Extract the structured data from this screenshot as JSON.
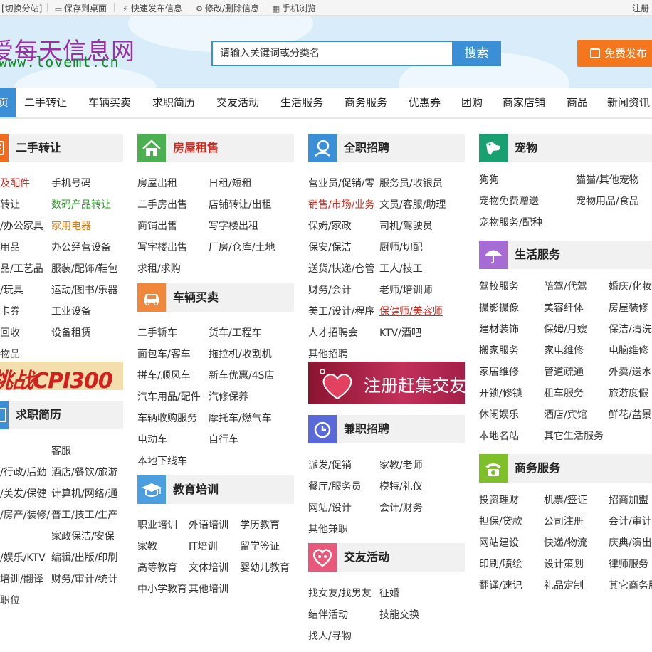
{
  "topbar": {
    "switch_site": "[切换分站]",
    "save_desktop": "保存到桌面",
    "quick_publish": "快速发布信息",
    "edit_delete": "修改/删除信息",
    "mobile_browse": "手机浏览",
    "register": "注册"
  },
  "header": {
    "logo_cn": "爱每天信息网",
    "logo_en": "www.lovemt.cn",
    "search_placeholder": "请输入关键词或分类名",
    "search_button": "搜索",
    "publish_button": "免费发布"
  },
  "nav": {
    "home": "页",
    "items": [
      "二手转让",
      "车辆买卖",
      "求职简历",
      "交友活动",
      "生活服务",
      "商务服务",
      "优惠券",
      "团购",
      "商家店铺",
      "商品",
      "新闻资讯"
    ]
  },
  "col1": {
    "ershou": {
      "title": "二手转让",
      "links": [
        "及配件",
        "手机号码",
        "转让",
        "数码产品转让",
        "/办公家具",
        "家用电器",
        "用品",
        "办公经营设备",
        "品/工艺品",
        "服装/配饰/鞋包",
        "/玩具",
        "运动/图书/乐器",
        "卡券",
        "工业设备",
        "回收",
        "设备租赁",
        "物品"
      ]
    },
    "banner_text": "挑战CPI300",
    "qiuzhi": {
      "title": "求职简历",
      "links": [
        "",
        "客服",
        "/行政/后勤",
        "酒店/餐饮/旅游",
        "/美发/保健",
        "计算机/网络/通",
        "/房产/装修/",
        "普工/技工/生产",
        "",
        "家政保洁/安保",
        "/娱乐/KTV",
        "编辑/出版/印刷",
        "培训/翻译",
        "财务/审计/统计",
        "职位",
        ""
      ]
    }
  },
  "col2": {
    "fangwu": {
      "title": "房屋租售",
      "links": [
        "房屋出租",
        "日租/短租",
        "二手房出售",
        "店铺转让/出租",
        "商铺出售",
        "写字楼出租",
        "写字楼出售",
        "厂房/仓库/土地",
        "求租/求购",
        ""
      ]
    },
    "cheliang": {
      "title": "车辆买卖",
      "links": [
        "二手轿车",
        "货车/工程车",
        "面包车/客车",
        "拖拉机/收割机",
        "拼车/顺风车",
        "新车优惠/4S店",
        "汽车用品/配件",
        "汽修保养",
        "车辆收购服务",
        "摩托车/燃气车",
        "电动车",
        "自行车",
        "本地下线车",
        ""
      ]
    },
    "jiaoyu": {
      "title": "教育培训",
      "links": [
        "职业培训",
        "外语培训",
        "学历教育",
        "家教",
        "IT培训",
        "留学签证",
        "高等教育",
        "文体培训",
        "婴幼儿教育",
        "中小学教育",
        "其他培训",
        ""
      ]
    }
  },
  "col3": {
    "quanzhi": {
      "title": "全职招聘",
      "links": [
        "营业员/促销/零",
        "服务员/收银员",
        "销售/市场/业务",
        "文员/客服/助理",
        "保姆/家政",
        "司机/驾驶员",
        "保安/保洁",
        "厨师/切配",
        "送货/快递/仓管",
        "工人/技工",
        "财务/会计",
        "老师/培训师",
        "美工/设计/程序",
        "保健师/美容师",
        "人才招聘会",
        "KTV/酒吧",
        "其他招聘",
        ""
      ]
    },
    "banner_text": "注册赶集交友",
    "jianzhi": {
      "title": "兼职招聘",
      "links": [
        "派发/促销",
        "家教/老师",
        "餐厅/服务员",
        "模特/礼仪",
        "网站/设计",
        "会计/财务",
        "其他兼职",
        ""
      ]
    },
    "jiaoyou": {
      "title": "交友活动",
      "links": [
        "找女友/找男友",
        "征婚",
        "结伴活动",
        "技能交换",
        "找人/寻物",
        ""
      ]
    }
  },
  "col4": {
    "chongwu": {
      "title": "宠物",
      "links": [
        "狗狗",
        "猫猫/其他宠物",
        "宠物免费赠送",
        "宠物用品/食品",
        "宠物服务/配种",
        ""
      ]
    },
    "shenghuo": {
      "title": "生活服务",
      "links": [
        "驾校服务",
        "陪驾/代驾",
        "婚庆/化妆",
        "摄影摄像",
        "美容纤体",
        "房屋装修",
        "建材装饰",
        "保姆/月嫂",
        "保洁/清洗",
        "搬家服务",
        "家电维修",
        "电脑维修",
        "家居维修",
        "管道疏通",
        "外卖/送水",
        "开锁/修锁",
        "租车服务",
        "旅游度假",
        "休闲娱乐",
        "酒店/宾馆",
        "鲜花/盆景",
        "本地名站",
        "其它生活服务",
        ""
      ]
    },
    "shangwu": {
      "title": "商务服务",
      "links": [
        "投资理财",
        "机票/签证",
        "招商加盟",
        "担保/贷款",
        "公司注册",
        "会计/审计",
        "网站建设",
        "快递/物流",
        "庆典/演出",
        "印刷/喷绘",
        "设计策划",
        "律师服务",
        "翻译/速记",
        "礼品定制",
        "其它商务服务"
      ]
    }
  },
  "colors": {
    "accent_blue": "#3a8fd6",
    "publish_orange": "#f4771d",
    "link_red": "#d6281e",
    "link_green": "#2b9a2b",
    "link_orange": "#e17a13"
  }
}
